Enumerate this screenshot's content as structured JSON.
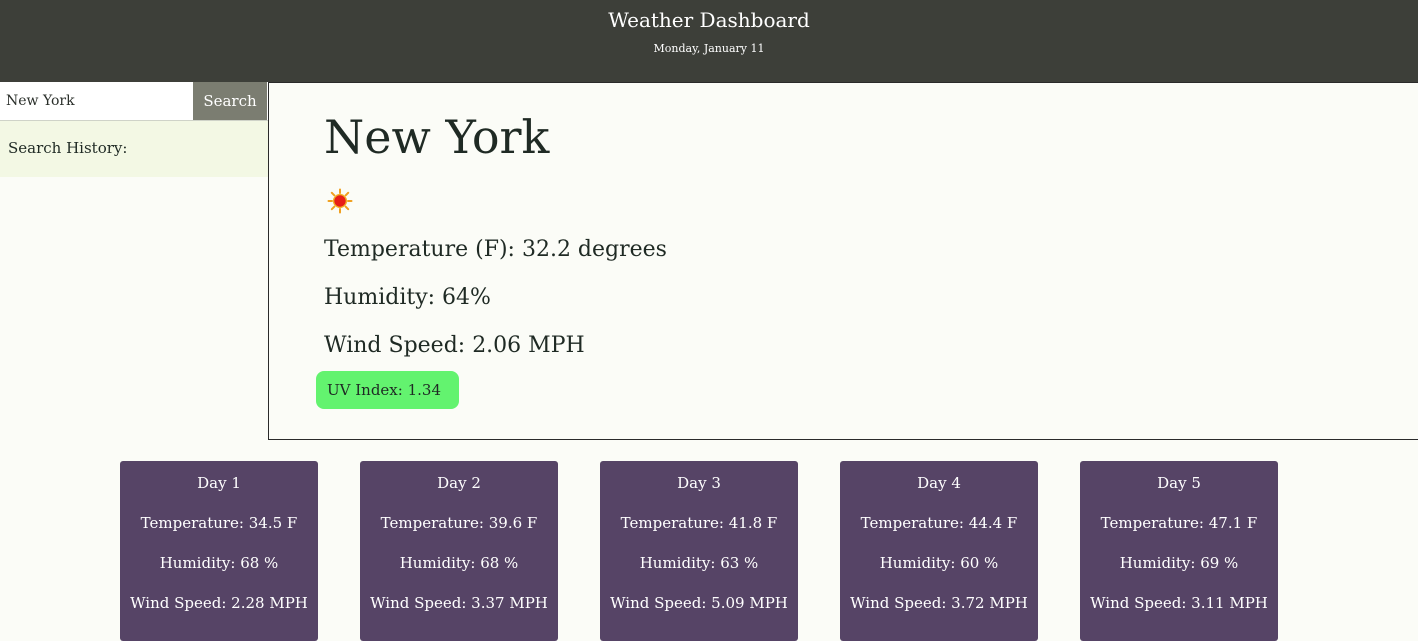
{
  "header": {
    "title": "Weather Dashboard",
    "date": "Monday, January 11"
  },
  "search": {
    "value": "New York",
    "button_label": "Search",
    "history_label": "Search History:"
  },
  "current": {
    "city": "New York",
    "icon": "sun-icon",
    "temperature": "Temperature (F): 32.2 degrees",
    "humidity": "Humidity: 64%",
    "wind": "Wind Speed: 2.06 MPH",
    "uv": "UV Index: 1.34"
  },
  "colors": {
    "header_bg": "#3d3f39",
    "search_button_bg": "#7b7d71",
    "history_bg": "#f3f8e4",
    "uv_bg": "#63f36f",
    "forecast_bg": "#564466"
  },
  "forecast": [
    {
      "day": "Day 1",
      "temp": "Temperature: 34.5 F",
      "humidity": "Humidity: 68 %",
      "wind": "Wind Speed: 2.28 MPH"
    },
    {
      "day": "Day 2",
      "temp": "Temperature: 39.6 F",
      "humidity": "Humidity: 68 %",
      "wind": "Wind Speed: 3.37 MPH"
    },
    {
      "day": "Day 3",
      "temp": "Temperature: 41.8 F",
      "humidity": "Humidity: 63 %",
      "wind": "Wind Speed: 5.09 MPH"
    },
    {
      "day": "Day 4",
      "temp": "Temperature: 44.4 F",
      "humidity": "Humidity: 60 %",
      "wind": "Wind Speed: 3.72 MPH"
    },
    {
      "day": "Day 5",
      "temp": "Temperature: 47.1 F",
      "humidity": "Humidity: 69 %",
      "wind": "Wind Speed: 3.11 MPH"
    }
  ]
}
